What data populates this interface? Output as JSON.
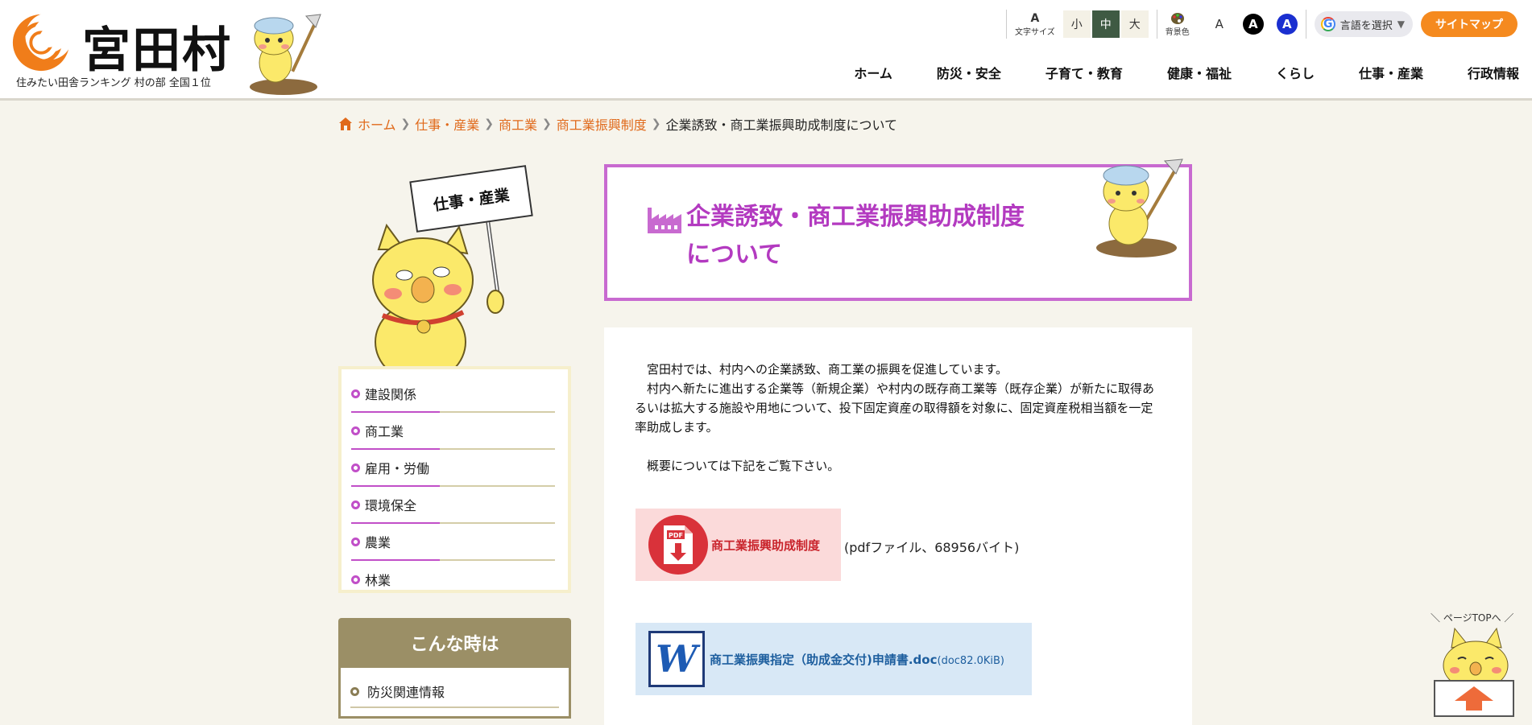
{
  "site": {
    "name": "宮田村",
    "tagline": "住みたい田舎ランキング 村の部 全国１位"
  },
  "tools": {
    "font_size_label": "文字サイズ",
    "font_size_glyph": "A",
    "sizes": [
      "小",
      "中",
      "大"
    ],
    "active_size": "中",
    "bg_label": "背景色",
    "bg_options": [
      "A",
      "A",
      "A"
    ],
    "language_label": "言語を選択",
    "sitemap_label": "サイトマップ"
  },
  "gnav": [
    "ホーム",
    "防災・安全",
    "子育て・教育",
    "健康・福祉",
    "くらし",
    "仕事・産業",
    "行政情報"
  ],
  "breadcrumb": {
    "items": [
      "ホーム",
      "仕事・産業",
      "商工業",
      "商工業振興制度"
    ],
    "current": "企業誘致・商工業振興助成制度について"
  },
  "sidebar": {
    "sign": "仕事・産業",
    "items": [
      "建設関係",
      "商工業",
      "雇用・労働",
      "環境保全",
      "農業",
      "林業"
    ],
    "konna_title": "こんな時は",
    "konna_items": [
      "防災関連情報"
    ]
  },
  "page": {
    "title": "企業誘致・商工業振興助成制度について",
    "paragraph": "　宮田村では、村内への企業誘致、商工業の振興を促進しています。\n　村内へ新たに進出する企業等（新規企業）や村内の既存商工業等（既存企業）が新たに取得あるいは拡大する施設や用地について、投下固定資産の取得額を対象に、固定資産税相当額を一定率助成します。\n\n　概要については下記をご覧下さい。",
    "pdf_icon_text": "PDF",
    "pdf_label": "商工業振興助成制度",
    "pdf_meta": "(pdfファイル、68956バイト)",
    "doc_label": "商工業振興指定（助成金交付)申請書.doc",
    "doc_size": "(doc82.0KiB)"
  },
  "pagetop": {
    "label": "＼ ページTOPへ ／"
  },
  "colors": {
    "accent_orange": "#f58a1f",
    "title_purple": "#b33ac0",
    "pdf_red": "#d9323a",
    "doc_blue": "#1d5e9e"
  }
}
